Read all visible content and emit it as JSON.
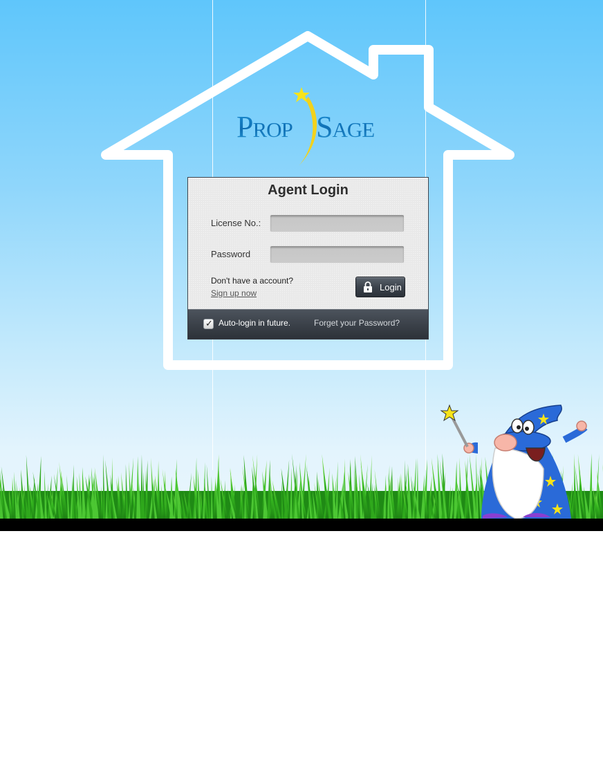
{
  "brand": {
    "name_part1": "Prop",
    "name_part2": "Sage",
    "logo_colors": {
      "primary": "#1585cc",
      "star": "#f7e31a"
    }
  },
  "login_panel": {
    "title": "Agent Login",
    "license_label": "License No.:",
    "license_value": "",
    "password_label": "Password",
    "password_value": "",
    "no_account_text": "Don't have a account?",
    "signup_link": "Sign up now",
    "login_button": "Login",
    "login_icon": "lock-icon"
  },
  "footer": {
    "auto_login_label": "Auto-login in future.",
    "auto_login_checked": true,
    "forgot_link": "Forget your Password?"
  },
  "colors": {
    "sky_top": "#5fc6fb",
    "sky_bottom": "#e9f6fd",
    "grass": "#3fbf2a",
    "panel_footer": "#3a4048"
  },
  "decorations": {
    "mascot": "wizard-mascot",
    "house_outline": "house-outline"
  }
}
